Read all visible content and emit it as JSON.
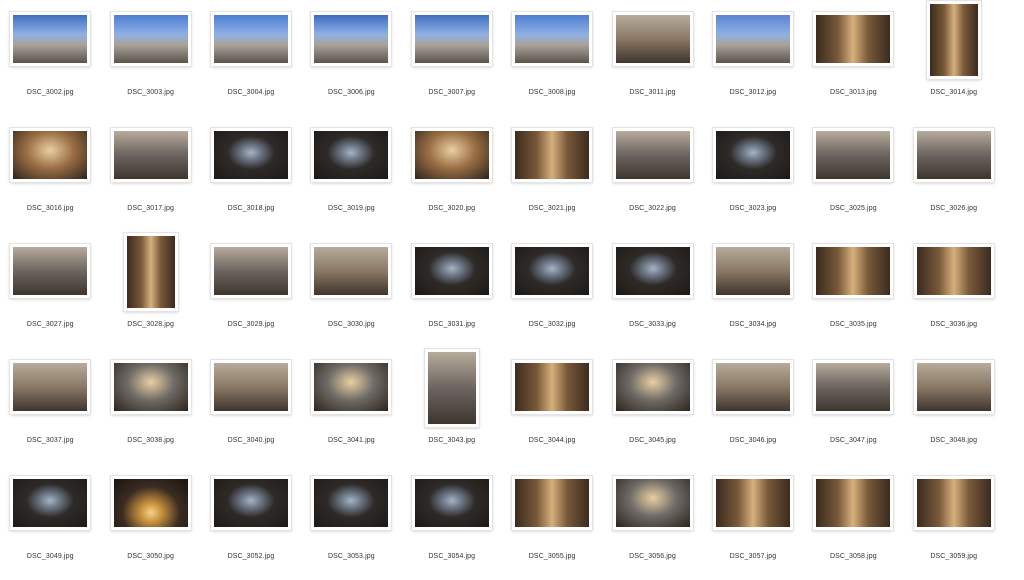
{
  "files": [
    {
      "name": "DSC_3002.jpg",
      "orientation": "landscape",
      "tone": "sky-exterior"
    },
    {
      "name": "DSC_3003.jpg",
      "orientation": "landscape",
      "tone": "sky-tower"
    },
    {
      "name": "DSC_3004.jpg",
      "orientation": "landscape",
      "tone": "sky-tower"
    },
    {
      "name": "DSC_3006.jpg",
      "orientation": "landscape",
      "tone": "sky-spires"
    },
    {
      "name": "DSC_3007.jpg",
      "orientation": "landscape",
      "tone": "sky-exterior"
    },
    {
      "name": "DSC_3008.jpg",
      "orientation": "landscape",
      "tone": "sky-tower"
    },
    {
      "name": "DSC_3011.jpg",
      "orientation": "landscape",
      "tone": "stone-facade"
    },
    {
      "name": "DSC_3012.jpg",
      "orientation": "landscape",
      "tone": "sky-gate"
    },
    {
      "name": "DSC_3013.jpg",
      "orientation": "landscape",
      "tone": "nave-warm"
    },
    {
      "name": "DSC_3014.jpg",
      "orientation": "portrait",
      "tone": "nave-warm"
    },
    {
      "name": "DSC_3016.jpg",
      "orientation": "landscape",
      "tone": "vault-warm"
    },
    {
      "name": "DSC_3017.jpg",
      "orientation": "landscape",
      "tone": "interior-grey"
    },
    {
      "name": "DSC_3018.jpg",
      "orientation": "landscape",
      "tone": "window-dark"
    },
    {
      "name": "DSC_3019.jpg",
      "orientation": "landscape",
      "tone": "window-dark"
    },
    {
      "name": "DSC_3020.jpg",
      "orientation": "landscape",
      "tone": "vault-warm"
    },
    {
      "name": "DSC_3021.jpg",
      "orientation": "landscape",
      "tone": "nave-warm"
    },
    {
      "name": "DSC_3022.jpg",
      "orientation": "landscape",
      "tone": "interior-grey"
    },
    {
      "name": "DSC_3023.jpg",
      "orientation": "landscape",
      "tone": "window-dark"
    },
    {
      "name": "DSC_3025.jpg",
      "orientation": "landscape",
      "tone": "interior-grey"
    },
    {
      "name": "DSC_3026.jpg",
      "orientation": "landscape",
      "tone": "interior-grey"
    },
    {
      "name": "DSC_3027.jpg",
      "orientation": "landscape",
      "tone": "interior-grey"
    },
    {
      "name": "DSC_3028.jpg",
      "orientation": "portrait",
      "tone": "nave-warm"
    },
    {
      "name": "DSC_3029.jpg",
      "orientation": "landscape",
      "tone": "interior-grey"
    },
    {
      "name": "DSC_3030.jpg",
      "orientation": "landscape",
      "tone": "stone-facade"
    },
    {
      "name": "DSC_3031.jpg",
      "orientation": "landscape",
      "tone": "window-dark"
    },
    {
      "name": "DSC_3032.jpg",
      "orientation": "landscape",
      "tone": "window-dark"
    },
    {
      "name": "DSC_3033.jpg",
      "orientation": "landscape",
      "tone": "window-dark"
    },
    {
      "name": "DSC_3034.jpg",
      "orientation": "landscape",
      "tone": "stone-facade"
    },
    {
      "name": "DSC_3035.jpg",
      "orientation": "landscape",
      "tone": "nave-warm"
    },
    {
      "name": "DSC_3036.jpg",
      "orientation": "landscape",
      "tone": "nave-warm"
    },
    {
      "name": "DSC_3037.jpg",
      "orientation": "landscape",
      "tone": "stone-facade"
    },
    {
      "name": "DSC_3038.jpg",
      "orientation": "landscape",
      "tone": "vault-grey"
    },
    {
      "name": "DSC_3040.jpg",
      "orientation": "landscape",
      "tone": "stone-facade"
    },
    {
      "name": "DSC_3041.jpg",
      "orientation": "landscape",
      "tone": "vault-grey"
    },
    {
      "name": "DSC_3043.jpg",
      "orientation": "portrait",
      "tone": "interior-grey"
    },
    {
      "name": "DSC_3044.jpg",
      "orientation": "landscape",
      "tone": "nave-warm"
    },
    {
      "name": "DSC_3045.jpg",
      "orientation": "landscape",
      "tone": "vault-grey"
    },
    {
      "name": "DSC_3046.jpg",
      "orientation": "landscape",
      "tone": "stone-facade"
    },
    {
      "name": "DSC_3047.jpg",
      "orientation": "landscape",
      "tone": "interior-grey"
    },
    {
      "name": "DSC_3048.jpg",
      "orientation": "landscape",
      "tone": "stone-facade"
    },
    {
      "name": "DSC_3049.jpg",
      "orientation": "landscape",
      "tone": "window-dark"
    },
    {
      "name": "DSC_3050.jpg",
      "orientation": "landscape",
      "tone": "candles"
    },
    {
      "name": "DSC_3052.jpg",
      "orientation": "landscape",
      "tone": "window-dark"
    },
    {
      "name": "DSC_3053.jpg",
      "orientation": "landscape",
      "tone": "window-dark"
    },
    {
      "name": "DSC_3054.jpg",
      "orientation": "landscape",
      "tone": "window-dark"
    },
    {
      "name": "DSC_3055.jpg",
      "orientation": "landscape",
      "tone": "nave-warm"
    },
    {
      "name": "DSC_3056.jpg",
      "orientation": "landscape",
      "tone": "vault-grey"
    },
    {
      "name": "DSC_3057.jpg",
      "orientation": "landscape",
      "tone": "nave-warm"
    },
    {
      "name": "DSC_3058.jpg",
      "orientation": "landscape",
      "tone": "nave-warm"
    },
    {
      "name": "DSC_3059.jpg",
      "orientation": "landscape",
      "tone": "nave-warm"
    }
  ],
  "palettes": {
    "sky-exterior": "#3f6fbf",
    "sky-tower": "#4d7fd0",
    "sky-spires": "#3c6cbf",
    "sky-gate": "#5a86cf",
    "stone-facade": "#8a7865",
    "nave-warm": "#7a5a3a",
    "vault-warm": "#9a6e44",
    "vault-grey": "#6e6a66",
    "interior-grey": "#6b6460",
    "window-dark": "#2e2a28",
    "candles": "#3a2c22"
  }
}
